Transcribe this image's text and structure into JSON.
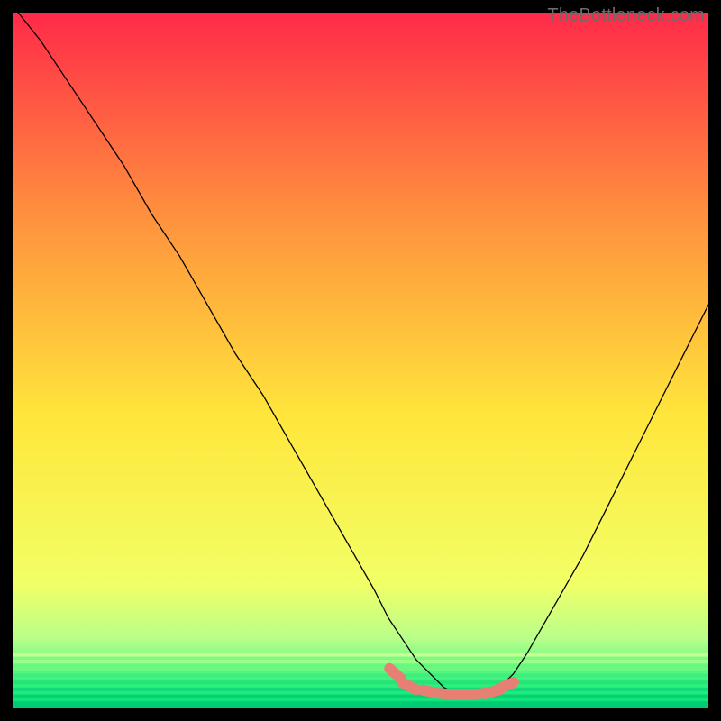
{
  "attribution": "TheBottleneck.com",
  "colors": {
    "curve": "#000000",
    "marker": "#e77f74",
    "gradient_top": "#ff2a49",
    "gradient_mid_upper": "#ff8d3e",
    "gradient_mid": "#ffe63b",
    "gradient_lower": "#f2ff66",
    "gradient_green1": "#b8ff8a",
    "gradient_green2": "#38f57e",
    "gradient_green3": "#00de77"
  },
  "chart_data": {
    "type": "line",
    "title": "",
    "xlabel": "",
    "ylabel": "",
    "xlim": [
      0,
      100
    ],
    "ylim": [
      0,
      100
    ],
    "series": [
      {
        "name": "bottleneck-curve",
        "x": [
          0,
          4,
          8,
          12,
          16,
          20,
          24,
          28,
          32,
          36,
          40,
          44,
          48,
          52,
          54,
          56,
          58,
          60,
          62,
          64,
          66,
          68,
          70,
          72,
          74,
          78,
          82,
          86,
          90,
          94,
          98,
          100
        ],
        "y": [
          101,
          96,
          90,
          84,
          78,
          71,
          65,
          58,
          51,
          45,
          38,
          31,
          24,
          17,
          13,
          10,
          7,
          5,
          3,
          2,
          2,
          2,
          3,
          5,
          8,
          15,
          22,
          30,
          38,
          46,
          54,
          58
        ]
      }
    ],
    "markers": {
      "name": "optimal-range",
      "x": [
        55,
        57,
        60,
        62,
        64,
        65,
        67,
        69,
        71
      ],
      "y": [
        5,
        3.2,
        2.4,
        2.1,
        2,
        2,
        2.1,
        2.4,
        3.3
      ]
    }
  }
}
